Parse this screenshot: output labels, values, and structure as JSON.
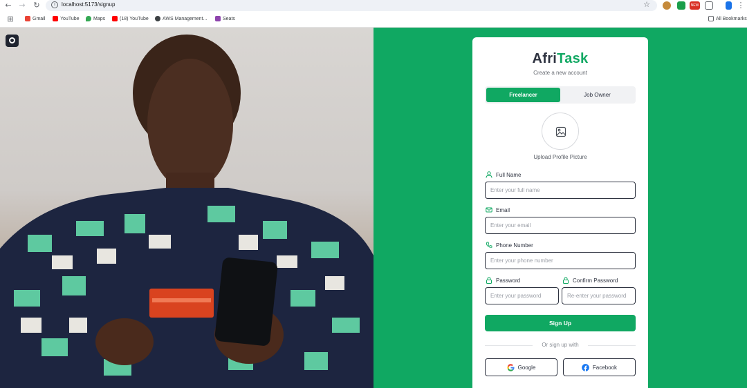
{
  "browser": {
    "url": "localhost:5173/signup",
    "bookmarks": [
      {
        "label": "Gmail",
        "icon": "gmail-icon"
      },
      {
        "label": "YouTube",
        "icon": "youtube-icon"
      },
      {
        "label": "Maps",
        "icon": "maps-icon"
      },
      {
        "label": "(18) YouTube",
        "icon": "youtube-icon"
      },
      {
        "label": "AWS Management...",
        "icon": "aws-icon"
      },
      {
        "label": "Seats",
        "icon": "seats-icon"
      }
    ],
    "all_bookmarks": "All Bookmarks",
    "new_badge": "NEW"
  },
  "brand": {
    "prefix": "Afri",
    "accent": "Task"
  },
  "subtitle": "Create a new account",
  "role_toggle": {
    "freelancer": "Freelancer",
    "job_owner": "Job Owner"
  },
  "upload": {
    "label": "Upload Profile Picture"
  },
  "form": {
    "full_name": {
      "label": "Full Name",
      "placeholder": "Enter your full name"
    },
    "email": {
      "label": "Email",
      "placeholder": "Enter your email"
    },
    "phone": {
      "label": "Phone Number",
      "placeholder": "Enter your phone number"
    },
    "password": {
      "label": "Password",
      "placeholder": "Enter your password"
    },
    "confirm_password": {
      "label": "Confirm Password",
      "placeholder": "Re-enter your password"
    }
  },
  "signup_button": "Sign Up",
  "divider": "Or sign up with",
  "social": {
    "google": "Google",
    "facebook": "Facebook"
  },
  "colors": {
    "accent": "#10a862",
    "text": "#2e3340"
  }
}
